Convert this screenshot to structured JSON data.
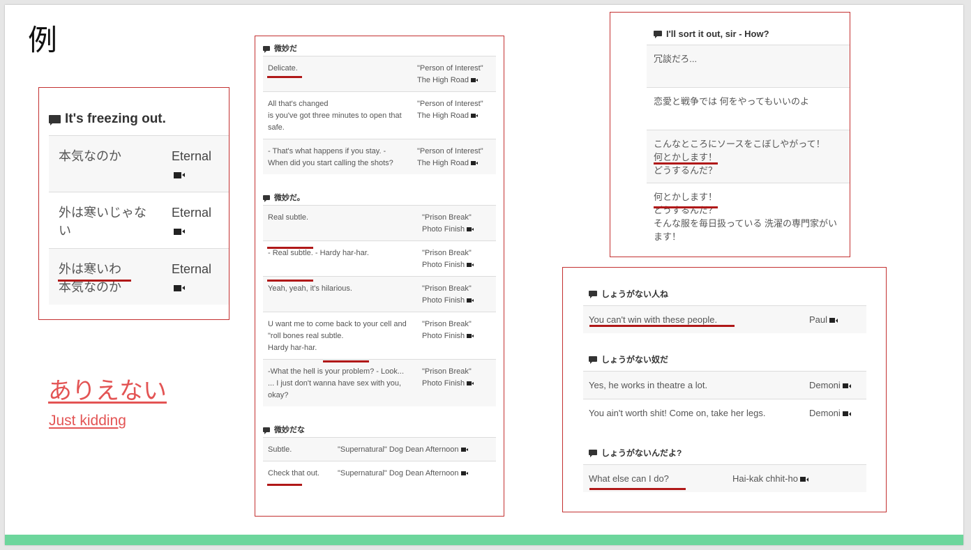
{
  "slide": {
    "title": "例",
    "link_japanese": "ありえない",
    "link_english": "Just kidding",
    "accent": "#e35454",
    "bar_color": "#6dd69c"
  },
  "panel1": {
    "heading": "It's freezing out.",
    "rows": [
      {
        "text": "本気なのか",
        "source": "Eternal"
      },
      {
        "text": "外は寒いじゃない",
        "source": "Eternal"
      },
      {
        "text": "外は寒いわ\n本気なのか",
        "source": "Eternal"
      }
    ]
  },
  "panel2": {
    "sections": [
      {
        "heading": "微妙だ",
        "rows": [
          {
            "text": "Delicate.",
            "source": "\"Person of Interest\" The High Road"
          },
          {
            "text": "All that's changed\nis you've got three minutes to open that safe.",
            "source": "\"Person of Interest\" The High Road"
          },
          {
            "text": "- That's what happens if you stay. - When did you start calling the shots?",
            "source": "\"Person of Interest\" The High Road"
          }
        ]
      },
      {
        "heading": "微妙だ。",
        "rows": [
          {
            "text": "Real subtle.",
            "source": "\"Prison Break\" Photo Finish"
          },
          {
            "text": "- Real subtle. - Hardy har-har.",
            "source": "\"Prison Break\" Photo Finish"
          },
          {
            "text": "Yeah, yeah, it's hilarious.",
            "source": "\"Prison Break\" Photo Finish"
          },
          {
            "text": "U want me to come back to your cell and \"roll bones real subtle.\nHardy har-har.",
            "source": "\"Prison Break\" Photo Finish"
          },
          {
            "text": "-What the hell is your problem? - Look...\n... I just don't wanna have sex with you, okay?",
            "source": "\"Prison Break\" Photo Finish"
          }
        ]
      },
      {
        "heading": "微妙だな",
        "rows": [
          {
            "text": "Subtle.",
            "source": "\"Supernatural\" Dog Dean Afternoon"
          },
          {
            "text": "Check that out.",
            "source": "\"Supernatural\" Dog Dean Afternoon"
          }
        ]
      }
    ]
  },
  "panel3": {
    "heading": "I'll sort it out, sir - How?",
    "rows": [
      {
        "text": "冗談だろ..."
      },
      {
        "text": "恋愛と戦争では 何をやってもいいのよ"
      },
      {
        "text": "こんなところにソースをこぼしやがって！\n何とかします！\nどうするんだ？"
      },
      {
        "text": "何とかします！\nどうするんだ？\nそんな服を毎日扱っている 洗濯の専門家がいます！"
      }
    ]
  },
  "panel4": {
    "sections": [
      {
        "heading": "しょうがない人ね",
        "rows": [
          {
            "text": "You can't win with these people.",
            "source": "Paul"
          }
        ]
      },
      {
        "heading": "しょうがない奴だ",
        "rows": [
          {
            "text": "Yes, he works in theatre a lot.",
            "source": "Demoni"
          },
          {
            "text": "You ain't worth shit! Come on, take her legs.",
            "source": "Demoni"
          }
        ]
      },
      {
        "heading": "しょうがないんだよ?",
        "rows": [
          {
            "text": "What else can I do?",
            "source": "Hai-kak chhit-ho"
          }
        ]
      }
    ]
  },
  "icons": {
    "section": "speech-bubble-icon",
    "source": "video-camera-icon"
  }
}
